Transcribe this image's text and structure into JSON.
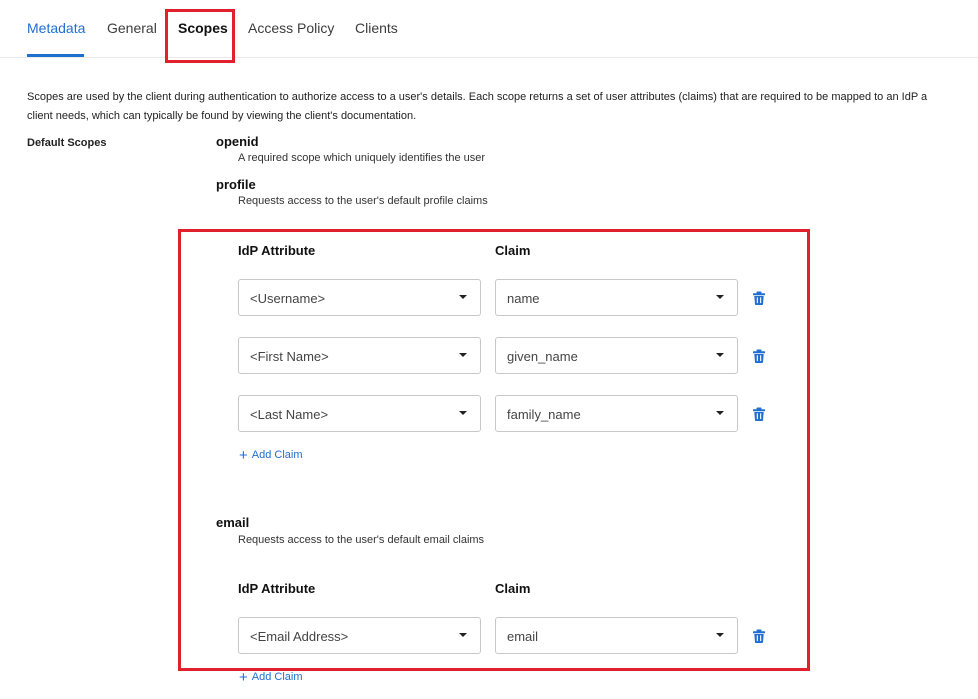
{
  "tabs": [
    {
      "label": "Metadata"
    },
    {
      "label": "General"
    },
    {
      "label": "Scopes"
    },
    {
      "label": "Access Policy"
    },
    {
      "label": "Clients"
    }
  ],
  "intro": {
    "line1": "Scopes are used by the client during authentication to authorize access to a user's details. Each scope returns a set of user attributes (claims) that are required to be mapped to an IdP a",
    "line2": "client needs, which can typically be found by viewing the client's documentation."
  },
  "default_scopes_label": "Default Scopes",
  "scopes": {
    "openid": {
      "name": "openid",
      "description": "A required scope which uniquely identifies the user"
    },
    "profile": {
      "name": "profile",
      "description": "Requests access to the user's default profile claims"
    },
    "email": {
      "name": "email",
      "description": "Requests access to the user's default email claims"
    }
  },
  "columns": {
    "attribute": "IdP Attribute",
    "claim": "Claim"
  },
  "profile_mappings": [
    {
      "attribute": "<Username>",
      "claim": "name"
    },
    {
      "attribute": "<First Name>",
      "claim": "given_name"
    },
    {
      "attribute": "<Last Name>",
      "claim": "family_name"
    }
  ],
  "email_mappings": [
    {
      "attribute": "<Email Address>",
      "claim": "email"
    }
  ],
  "add_claim_label": "Add Claim",
  "colors": {
    "accent": "#1f6fd1",
    "highlight": "#e0202b"
  },
  "icons": {
    "caret": "chevron-down-icon",
    "delete": "trash-icon",
    "add": "plus-icon"
  }
}
